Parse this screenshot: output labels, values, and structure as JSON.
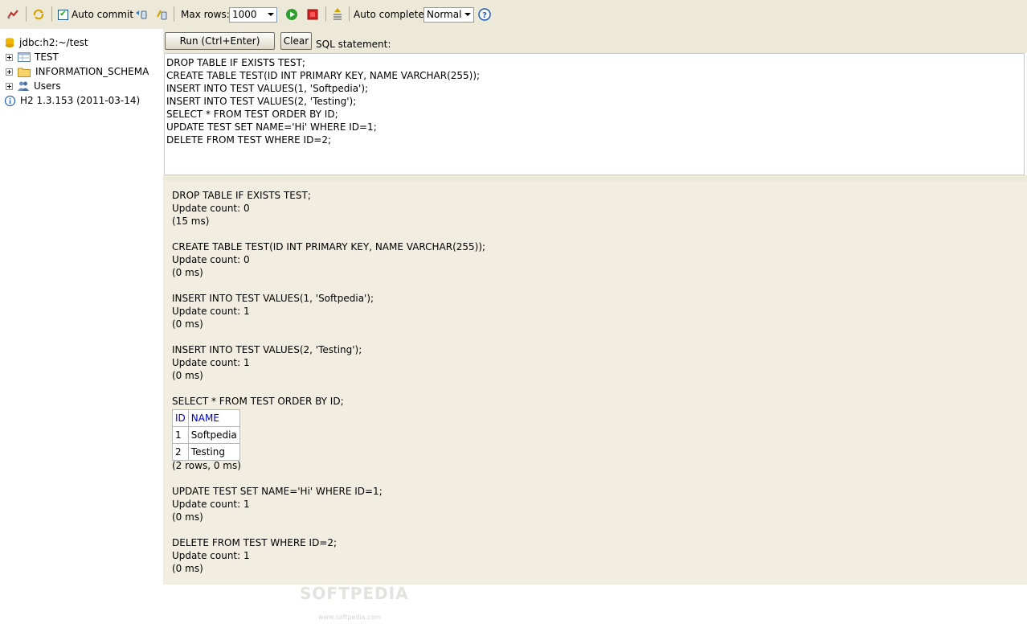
{
  "toolbar": {
    "auto_commit_label": "Auto commit",
    "auto_commit_checked": true,
    "max_rows_label": "Max rows:",
    "max_rows_value": "1000",
    "auto_complete_label": "Auto complete",
    "auto_complete_value": "Normal"
  },
  "tree": {
    "connection": "jdbc:h2:~/test",
    "items": [
      {
        "label": "TEST",
        "icon": "table-icon"
      },
      {
        "label": "INFORMATION_SCHEMA",
        "icon": "folder-icon"
      },
      {
        "label": "Users",
        "icon": "users-icon"
      }
    ],
    "version": "H2 1.3.153 (2011-03-14)"
  },
  "query": {
    "run_label": "Run (Ctrl+Enter)",
    "clear_label": "Clear",
    "sql_label": "SQL statement:",
    "lines": [
      "DROP TABLE IF EXISTS TEST;",
      "CREATE TABLE TEST(ID INT PRIMARY KEY, NAME VARCHAR(255));",
      "INSERT INTO TEST VALUES(1, 'Softpedia');",
      "INSERT INTO TEST VALUES(2, 'Testing');",
      "SELECT * FROM TEST ORDER BY ID;",
      "UPDATE TEST SET NAME='Hi' WHERE ID=1;",
      "DELETE FROM TEST WHERE ID=2;"
    ]
  },
  "results": {
    "blocks": [
      {
        "stmt": "DROP TABLE IF EXISTS TEST;",
        "count": "Update count: 0",
        "time": "(15 ms)"
      },
      {
        "stmt": "CREATE TABLE TEST(ID INT PRIMARY KEY, NAME VARCHAR(255));",
        "count": "Update count: 0",
        "time": "(0 ms)"
      },
      {
        "stmt": "INSERT INTO TEST VALUES(1, 'Softpedia');",
        "count": "Update count: 1",
        "time": "(0 ms)"
      },
      {
        "stmt": "INSERT INTO TEST VALUES(2, 'Testing');",
        "count": "Update count: 1",
        "time": "(0 ms)"
      }
    ],
    "select": {
      "stmt": "SELECT * FROM TEST ORDER BY ID;",
      "columns": [
        "ID",
        "NAME"
      ],
      "rows": [
        [
          "1",
          "Softpedia"
        ],
        [
          "2",
          "Testing"
        ]
      ],
      "summary": "(2 rows, 0 ms)"
    },
    "after": [
      {
        "stmt": "UPDATE TEST SET NAME='Hi' WHERE ID=1;",
        "count": "Update count: 1",
        "time": "(0 ms)"
      },
      {
        "stmt": "DELETE FROM TEST WHERE ID=2;",
        "count": "Update count: 1",
        "time": "(0 ms)"
      }
    ]
  },
  "watermark": {
    "text": "SOFTPEDIA",
    "sub": "www.softpedia.com"
  },
  "colors": {
    "toolbar_bg": "#ece9d8",
    "results_bg": "#f1ede0",
    "header_blue": "#0000c8"
  }
}
